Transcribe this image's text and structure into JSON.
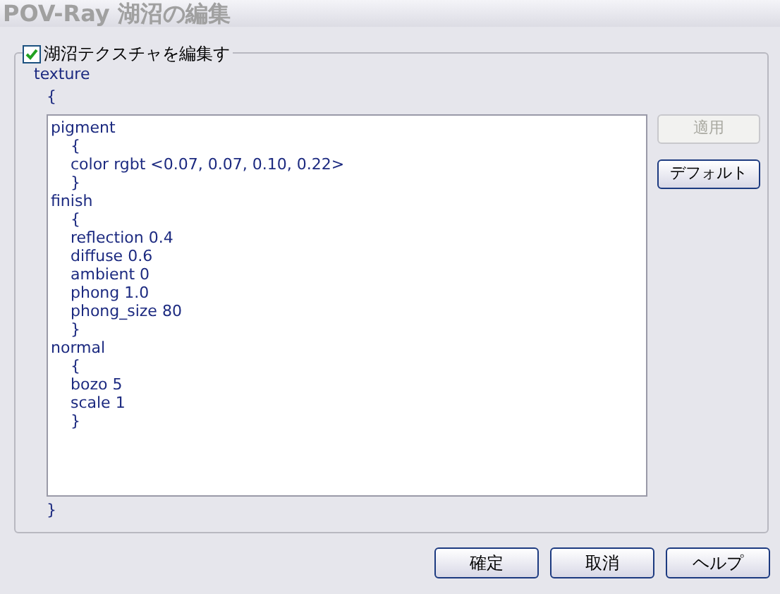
{
  "window": {
    "title": "POV-Ray 湖沼の編集"
  },
  "edit_checkbox": {
    "label": "湖沼テクスチャを編集す",
    "checked": true
  },
  "texture_label": "texture",
  "open_brace": "{",
  "editor_text": "pigment\n    {\n    color rgbt <0.07, 0.07, 0.10, 0.22>\n    }\nfinish\n    {\n    reflection 0.4\n    diffuse 0.6\n    ambient 0\n    phong 1.0\n    phong_size 80\n    }\nnormal\n    {\n    bozo 5\n    scale 1\n    }",
  "close_brace": "}",
  "side_buttons": [
    {
      "label": "適用",
      "disabled": true
    },
    {
      "label": "デフォルト",
      "disabled": false
    }
  ],
  "buttons": [
    "確定",
    "取消",
    "ヘルプ"
  ]
}
